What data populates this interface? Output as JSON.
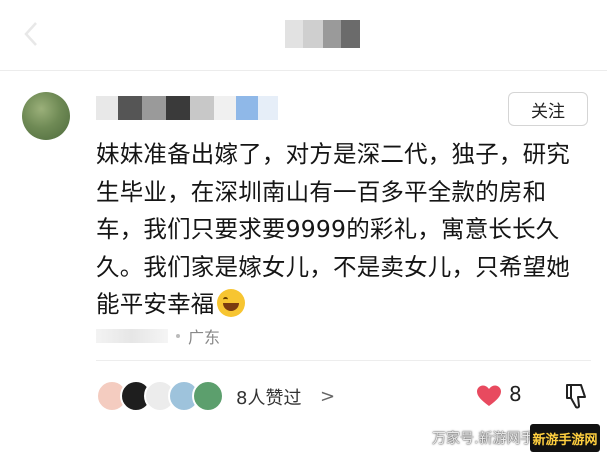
{
  "header": {
    "back_icon": "chevron-left-icon"
  },
  "comment": {
    "follow_label": "关注",
    "lines": [
      "妹妹准备出嫁了，对方是深二代，独子，研究",
      "生毕业，在深圳南山有一百多平全款的房和",
      "车，我们只要求要9999的彩礼，寓意长长久",
      "久。我们家是嫁女儿，不是卖女儿，只希望她",
      "能平安幸福"
    ],
    "emoji": "grinning-face-with-sweat",
    "location": "广东"
  },
  "footer": {
    "likes_text": "8人赞过",
    "chevron": ">",
    "like_count": "8",
    "heart_color": "#e84a5f"
  },
  "watermark": {
    "text": "万家号.新游网手游网",
    "logo_text": "新游手游网"
  }
}
